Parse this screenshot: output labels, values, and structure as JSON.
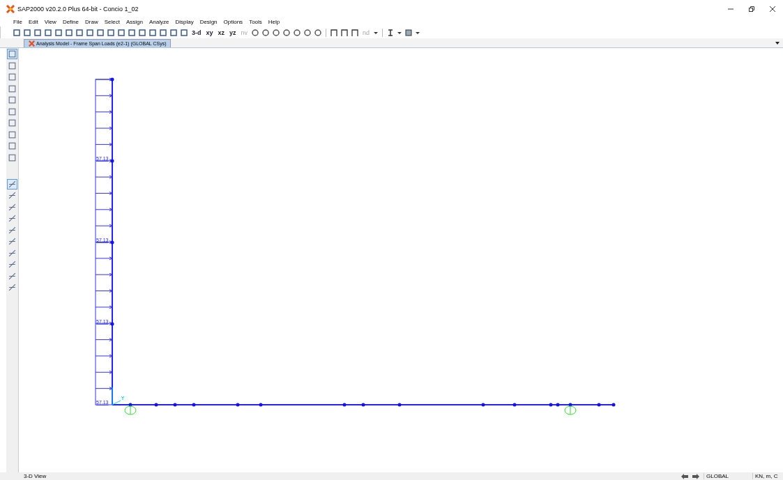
{
  "window": {
    "title": "SAP2000 v20.2.0 Plus 64-bit - Concio 1_02"
  },
  "menu": [
    "File",
    "Edit",
    "View",
    "Define",
    "Draw",
    "Select",
    "Assign",
    "Analyze",
    "Display",
    "Design",
    "Options",
    "Tools",
    "Help"
  ],
  "view_buttons": [
    {
      "label": "3-d",
      "disabled": false
    },
    {
      "label": "xy",
      "disabled": false
    },
    {
      "label": "xz",
      "disabled": false
    },
    {
      "label": "yz",
      "disabled": false
    },
    {
      "label": "nv",
      "disabled": true
    }
  ],
  "node_button": {
    "label": "nd",
    "disabled": true
  },
  "tab": {
    "title": "Analysis Model - Frame Span Loads (e2-1) (GLOBAL CSys)",
    "selected": true
  },
  "loads": {
    "labels": [
      "57.13",
      "57.13",
      "57.13",
      "57.13"
    ]
  },
  "status_bar": {
    "view": "3-D View",
    "coordinate_system": "GLOBAL",
    "units": "KN, m, C"
  }
}
